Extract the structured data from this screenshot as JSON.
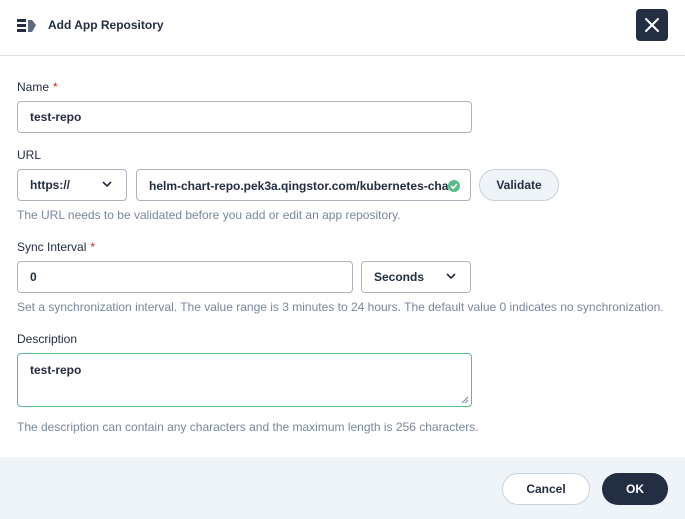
{
  "header": {
    "icon": "app-repository-icon",
    "title": "Add App Repository",
    "close_icon": "close-icon"
  },
  "form": {
    "name": {
      "label": "Name",
      "required_mark": "*",
      "value": "test-repo"
    },
    "url": {
      "label": "URL",
      "protocol": "https://",
      "value": "helm-chart-repo.pek3a.qingstor.com/kubernetes-cha",
      "validated_icon": "check-circle-icon",
      "validate_label": "Validate",
      "hint": "The URL needs to be validated before you add or edit an app repository."
    },
    "sync_interval": {
      "label": "Sync Interval",
      "required_mark": "*",
      "value": "0",
      "unit": "Seconds",
      "hint": "Set a synchronization interval. The value range is 3 minutes to 24 hours. The default value 0 indicates no synchronization."
    },
    "description": {
      "label": "Description",
      "value": "test-repo",
      "hint": "The description can contain any characters and the maximum length is 256 characters."
    }
  },
  "footer": {
    "cancel_label": "Cancel",
    "ok_label": "OK"
  },
  "colors": {
    "primary_dark": "#242e42",
    "required": "#ca2621",
    "success": "#55bc8a",
    "hint_text": "#79879c",
    "footer_bg": "#eff4f9"
  }
}
